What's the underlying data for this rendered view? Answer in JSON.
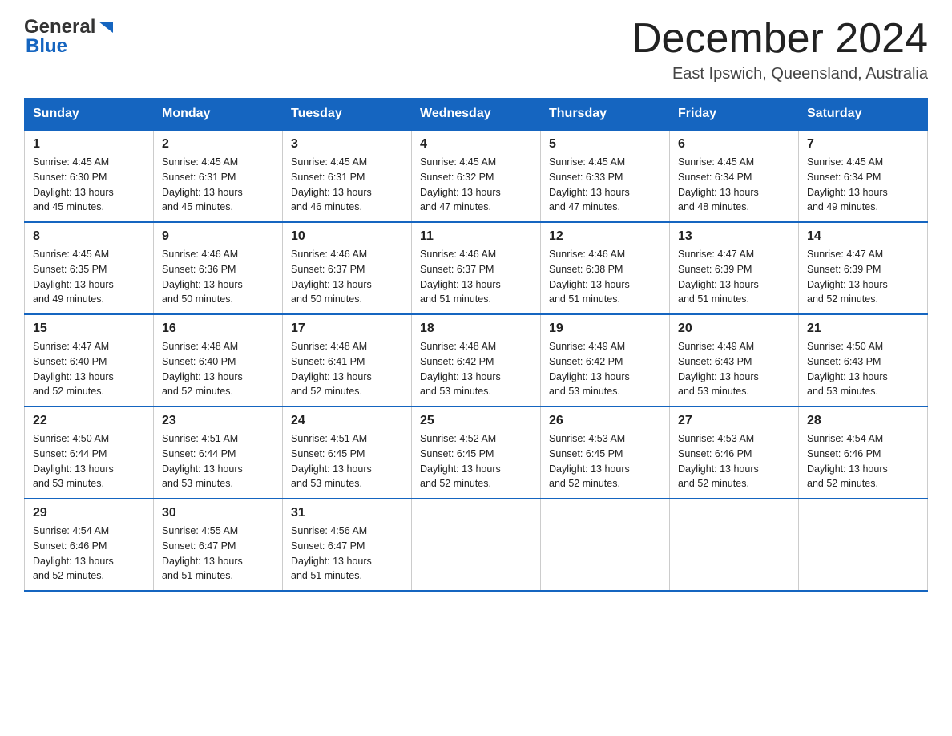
{
  "header": {
    "logo": {
      "general": "General",
      "triangle": "▶",
      "blue": "Blue"
    },
    "month_title": "December 2024",
    "location": "East Ipswich, Queensland, Australia"
  },
  "weekdays": [
    "Sunday",
    "Monday",
    "Tuesday",
    "Wednesday",
    "Thursday",
    "Friday",
    "Saturday"
  ],
  "weeks": [
    [
      {
        "day": "1",
        "sunrise": "4:45 AM",
        "sunset": "6:30 PM",
        "daylight": "13 hours and 45 minutes."
      },
      {
        "day": "2",
        "sunrise": "4:45 AM",
        "sunset": "6:31 PM",
        "daylight": "13 hours and 45 minutes."
      },
      {
        "day": "3",
        "sunrise": "4:45 AM",
        "sunset": "6:31 PM",
        "daylight": "13 hours and 46 minutes."
      },
      {
        "day": "4",
        "sunrise": "4:45 AM",
        "sunset": "6:32 PM",
        "daylight": "13 hours and 47 minutes."
      },
      {
        "day": "5",
        "sunrise": "4:45 AM",
        "sunset": "6:33 PM",
        "daylight": "13 hours and 47 minutes."
      },
      {
        "day": "6",
        "sunrise": "4:45 AM",
        "sunset": "6:34 PM",
        "daylight": "13 hours and 48 minutes."
      },
      {
        "day": "7",
        "sunrise": "4:45 AM",
        "sunset": "6:34 PM",
        "daylight": "13 hours and 49 minutes."
      }
    ],
    [
      {
        "day": "8",
        "sunrise": "4:45 AM",
        "sunset": "6:35 PM",
        "daylight": "13 hours and 49 minutes."
      },
      {
        "day": "9",
        "sunrise": "4:46 AM",
        "sunset": "6:36 PM",
        "daylight": "13 hours and 50 minutes."
      },
      {
        "day": "10",
        "sunrise": "4:46 AM",
        "sunset": "6:37 PM",
        "daylight": "13 hours and 50 minutes."
      },
      {
        "day": "11",
        "sunrise": "4:46 AM",
        "sunset": "6:37 PM",
        "daylight": "13 hours and 51 minutes."
      },
      {
        "day": "12",
        "sunrise": "4:46 AM",
        "sunset": "6:38 PM",
        "daylight": "13 hours and 51 minutes."
      },
      {
        "day": "13",
        "sunrise": "4:47 AM",
        "sunset": "6:39 PM",
        "daylight": "13 hours and 51 minutes."
      },
      {
        "day": "14",
        "sunrise": "4:47 AM",
        "sunset": "6:39 PM",
        "daylight": "13 hours and 52 minutes."
      }
    ],
    [
      {
        "day": "15",
        "sunrise": "4:47 AM",
        "sunset": "6:40 PM",
        "daylight": "13 hours and 52 minutes."
      },
      {
        "day": "16",
        "sunrise": "4:48 AM",
        "sunset": "6:40 PM",
        "daylight": "13 hours and 52 minutes."
      },
      {
        "day": "17",
        "sunrise": "4:48 AM",
        "sunset": "6:41 PM",
        "daylight": "13 hours and 52 minutes."
      },
      {
        "day": "18",
        "sunrise": "4:48 AM",
        "sunset": "6:42 PM",
        "daylight": "13 hours and 53 minutes."
      },
      {
        "day": "19",
        "sunrise": "4:49 AM",
        "sunset": "6:42 PM",
        "daylight": "13 hours and 53 minutes."
      },
      {
        "day": "20",
        "sunrise": "4:49 AM",
        "sunset": "6:43 PM",
        "daylight": "13 hours and 53 minutes."
      },
      {
        "day": "21",
        "sunrise": "4:50 AM",
        "sunset": "6:43 PM",
        "daylight": "13 hours and 53 minutes."
      }
    ],
    [
      {
        "day": "22",
        "sunrise": "4:50 AM",
        "sunset": "6:44 PM",
        "daylight": "13 hours and 53 minutes."
      },
      {
        "day": "23",
        "sunrise": "4:51 AM",
        "sunset": "6:44 PM",
        "daylight": "13 hours and 53 minutes."
      },
      {
        "day": "24",
        "sunrise": "4:51 AM",
        "sunset": "6:45 PM",
        "daylight": "13 hours and 53 minutes."
      },
      {
        "day": "25",
        "sunrise": "4:52 AM",
        "sunset": "6:45 PM",
        "daylight": "13 hours and 52 minutes."
      },
      {
        "day": "26",
        "sunrise": "4:53 AM",
        "sunset": "6:45 PM",
        "daylight": "13 hours and 52 minutes."
      },
      {
        "day": "27",
        "sunrise": "4:53 AM",
        "sunset": "6:46 PM",
        "daylight": "13 hours and 52 minutes."
      },
      {
        "day": "28",
        "sunrise": "4:54 AM",
        "sunset": "6:46 PM",
        "daylight": "13 hours and 52 minutes."
      }
    ],
    [
      {
        "day": "29",
        "sunrise": "4:54 AM",
        "sunset": "6:46 PM",
        "daylight": "13 hours and 52 minutes."
      },
      {
        "day": "30",
        "sunrise": "4:55 AM",
        "sunset": "6:47 PM",
        "daylight": "13 hours and 51 minutes."
      },
      {
        "day": "31",
        "sunrise": "4:56 AM",
        "sunset": "6:47 PM",
        "daylight": "13 hours and 51 minutes."
      },
      null,
      null,
      null,
      null
    ]
  ],
  "labels": {
    "sunrise": "Sunrise:",
    "sunset": "Sunset:",
    "daylight": "Daylight:"
  }
}
